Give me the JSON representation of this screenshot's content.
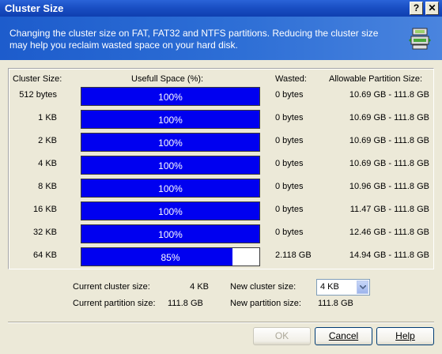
{
  "window": {
    "title": "Cluster Size",
    "help_glyph": "?",
    "close_glyph": "✕"
  },
  "header": {
    "description": "Changing the cluster size on FAT, FAT32 and NTFS partitions. Reducing the cluster size may help you reclaim wasted space on your hard disk.",
    "icon": "disk-cluster-icon"
  },
  "table": {
    "headers": {
      "cluster_size": "Cluster Size:",
      "useful_space": "Usefull Space (%):",
      "wasted": "Wasted:",
      "allowable": "Allowable Partition Size:"
    },
    "rows": [
      {
        "size": "512 bytes",
        "useful": "100%",
        "useful_fraction": 1.0,
        "wasted": "0 bytes",
        "allowable": "10.69 GB - 111.8 GB"
      },
      {
        "size": "1 KB",
        "useful": "100%",
        "useful_fraction": 1.0,
        "wasted": "0 bytes",
        "allowable": "10.69 GB - 111.8 GB"
      },
      {
        "size": "2 KB",
        "useful": "100%",
        "useful_fraction": 1.0,
        "wasted": "0 bytes",
        "allowable": "10.69 GB - 111.8 GB"
      },
      {
        "size": "4 KB",
        "useful": "100%",
        "useful_fraction": 1.0,
        "wasted": "0 bytes",
        "allowable": "10.69 GB - 111.8 GB"
      },
      {
        "size": "8 KB",
        "useful": "100%",
        "useful_fraction": 1.0,
        "wasted": "0 bytes",
        "allowable": "10.96 GB - 111.8 GB"
      },
      {
        "size": "16 KB",
        "useful": "100%",
        "useful_fraction": 1.0,
        "wasted": "0 bytes",
        "allowable": "11.47 GB - 111.8 GB"
      },
      {
        "size": "32 KB",
        "useful": "100%",
        "useful_fraction": 1.0,
        "wasted": "0 bytes",
        "allowable": "12.46 GB - 111.8 GB"
      },
      {
        "size": "64 KB",
        "useful": "85%",
        "useful_fraction": 0.85,
        "wasted": "2.118 GB",
        "allowable": "14.94 GB - 111.8 GB"
      }
    ],
    "bar_color": "#0000f0"
  },
  "info": {
    "current_cluster_label": "Current cluster size:",
    "current_cluster_value": "4 KB",
    "current_partition_label": "Current partition size:",
    "current_partition_value": "111.8 GB",
    "new_cluster_label": "New cluster size:",
    "new_cluster_value": "4 KB",
    "new_partition_label": "New partition size:",
    "new_partition_value": "111.8 GB"
  },
  "buttons": {
    "ok": "OK",
    "cancel": "Cancel",
    "help": "Help"
  }
}
